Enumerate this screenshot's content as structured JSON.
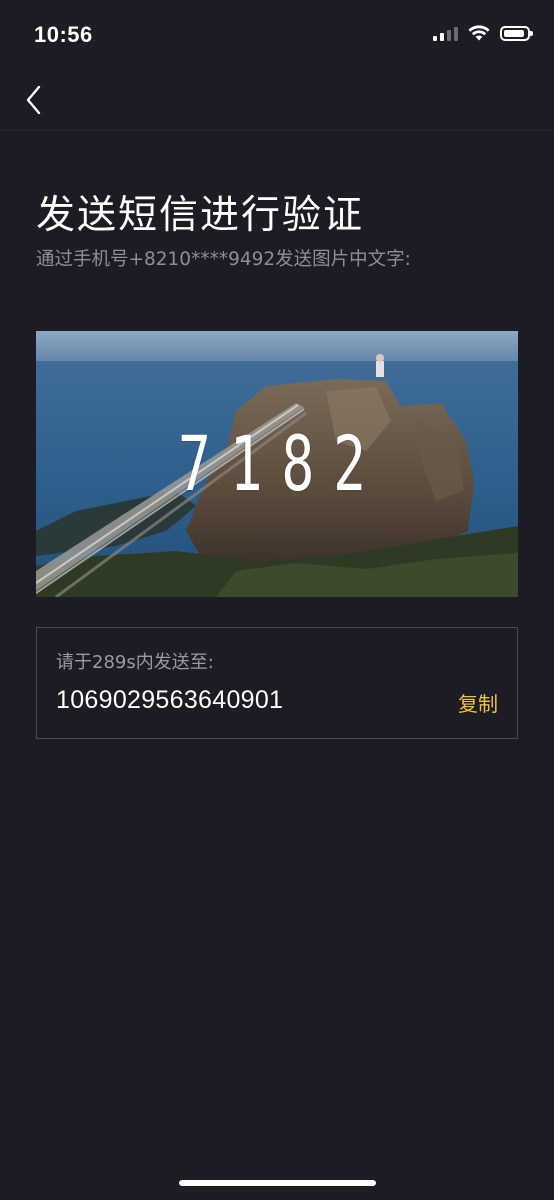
{
  "status_bar": {
    "time": "10:56"
  },
  "nav": {
    "back_icon": "chevron-left-icon"
  },
  "header": {
    "title": "发送短信进行验证",
    "subtitle": "通过手机号+8210****9492发送图片中文字:"
  },
  "captcha": {
    "code": "7182"
  },
  "send_box": {
    "hint": "请于289s内发送至:",
    "number": "1069029563640901",
    "copy_label": "复制"
  },
  "colors": {
    "background": "#1b1c24",
    "accent": "#f3c13a",
    "secondary_text": "#8e8f96",
    "box_border": "#4a4b53"
  }
}
